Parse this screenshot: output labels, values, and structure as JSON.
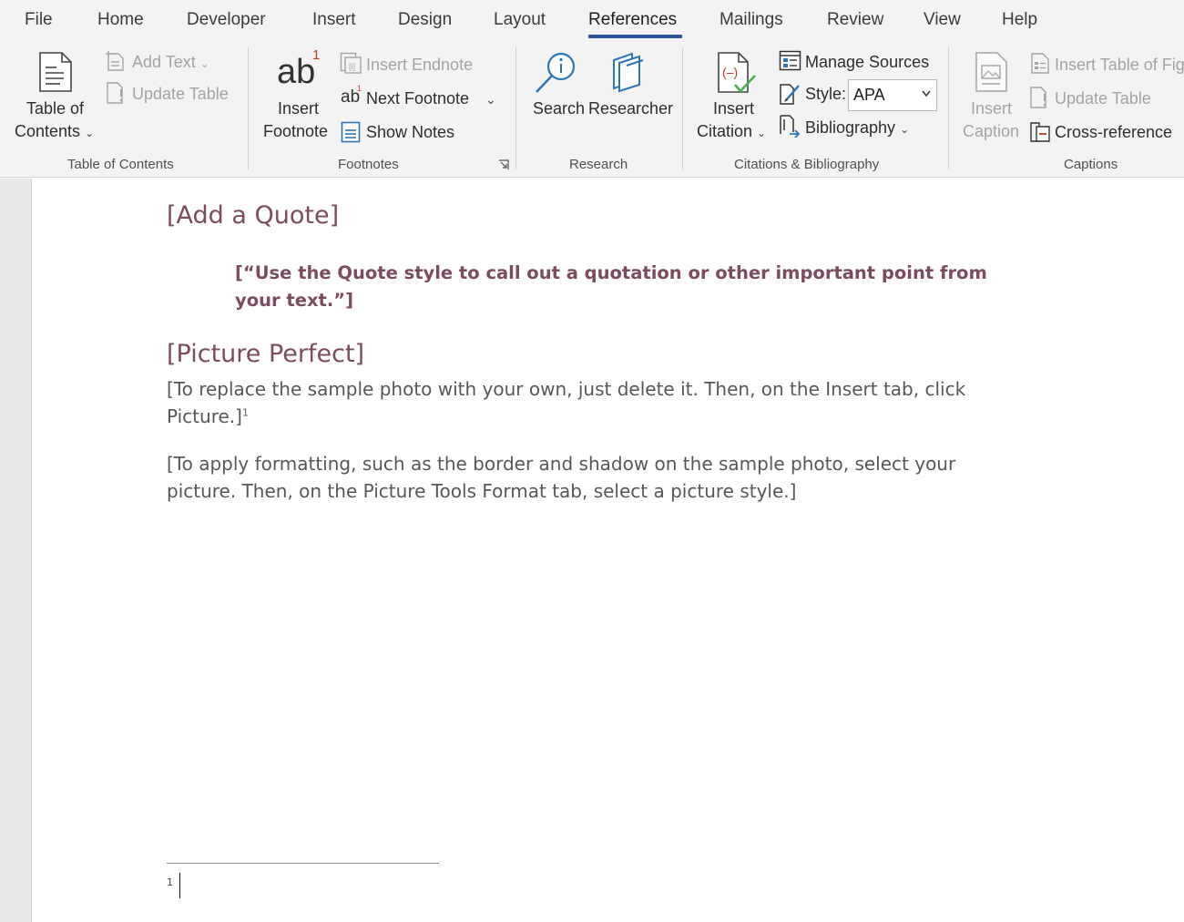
{
  "menu": {
    "tabs": [
      "File",
      "Home",
      "Developer",
      "Insert",
      "Design",
      "Layout",
      "References",
      "Mailings",
      "Review",
      "View",
      "Help"
    ],
    "active": "References"
  },
  "ribbon": {
    "toc_group": {
      "label": "Table of Contents",
      "table_of_contents_line1": "Table of",
      "table_of_contents_line2": "Contents",
      "add_text": "Add Text",
      "update_table": "Update Table"
    },
    "footnotes_group": {
      "label": "Footnotes",
      "insert_footnote_line1": "Insert",
      "insert_footnote_line2": "Footnote",
      "footnote_icon_text": "ab",
      "footnote_icon_super": "1",
      "insert_endnote": "Insert Endnote",
      "next_footnote": "Next Footnote",
      "show_notes": "Show Notes"
    },
    "research_group": {
      "label": "Research",
      "search": "Search",
      "researcher": "Researcher"
    },
    "citations_group": {
      "label": "Citations & Bibliography",
      "insert_citation_line1": "Insert",
      "insert_citation_line2": "Citation",
      "manage_sources": "Manage Sources",
      "style_label": "Style:",
      "style_value": "APA",
      "bibliography": "Bibliography"
    },
    "captions_group": {
      "label": "Captions",
      "insert_caption_line1": "Insert",
      "insert_caption_line2": "Caption",
      "insert_table_of_figures": "Insert Table of Fig",
      "update_table": "Update Table",
      "cross_reference": "Cross-reference"
    }
  },
  "document": {
    "heading_quote": "[Add a Quote]",
    "quote_text": "[“Use the Quote style to call out a quotation or other important point from your text.”]",
    "heading_picture": "[Picture Perfect]",
    "para1": "[To replace the sample photo with your own, just delete it. Then, on the Insert tab, click Picture.]",
    "para1_footnote_ref": "1",
    "para2": "[To apply formatting, such as the border and shadow on the sample photo, select your picture. Then, on the Picture Tools Format tab, select a picture style.]",
    "footnote_number": "1"
  },
  "colors": {
    "accent": "#2b579a",
    "heading": "#7b4c60",
    "footnote_mark": "#c0392b",
    "icon_blue": "#2e75b6",
    "citation_red": "#c0392b",
    "citation_green": "#4caf50"
  },
  "icons": [
    "table-of-contents-icon",
    "add-text-icon",
    "update-table-icon",
    "insert-footnote-icon",
    "insert-endnote-icon",
    "next-footnote-icon",
    "show-notes-icon",
    "search-icon",
    "researcher-icon",
    "insert-citation-icon",
    "manage-sources-icon",
    "style-icon",
    "bibliography-icon",
    "insert-caption-icon",
    "insert-table-of-figures-icon",
    "update-table-icon",
    "cross-reference-icon",
    "dialog-launcher-icon"
  ]
}
